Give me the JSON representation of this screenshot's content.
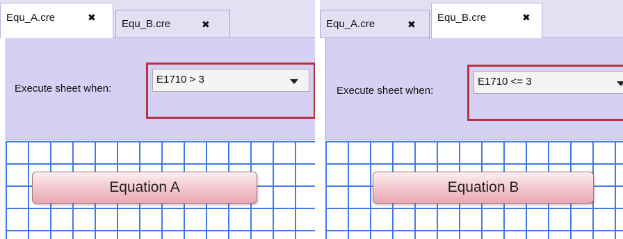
{
  "left_panel": {
    "tabs": [
      {
        "label": "Equ_A.cre",
        "active": true,
        "close_glyph": "✖"
      },
      {
        "label": "Equ_B.cre",
        "active": false,
        "close_glyph": "✖"
      }
    ],
    "condition_label": "Execute sheet when:",
    "condition_value": "E1710 > 3",
    "equation_button": "Equation A"
  },
  "right_panel": {
    "tabs": [
      {
        "label": "Equ_A.cre",
        "active": false,
        "close_glyph": "✖"
      },
      {
        "label": "Equ_B.cre",
        "active": true,
        "close_glyph": "✖"
      }
    ],
    "condition_label": "Execute sheet when:",
    "condition_value": "E1710 <= 3",
    "equation_button": "Equation B"
  },
  "colors": {
    "tabbar": "#e3e0f4",
    "properties_panel": "#d6d0f4",
    "highlight": "#b5343f",
    "grid_line": "#3f7be6",
    "button_fill": "#f4cdd3"
  }
}
